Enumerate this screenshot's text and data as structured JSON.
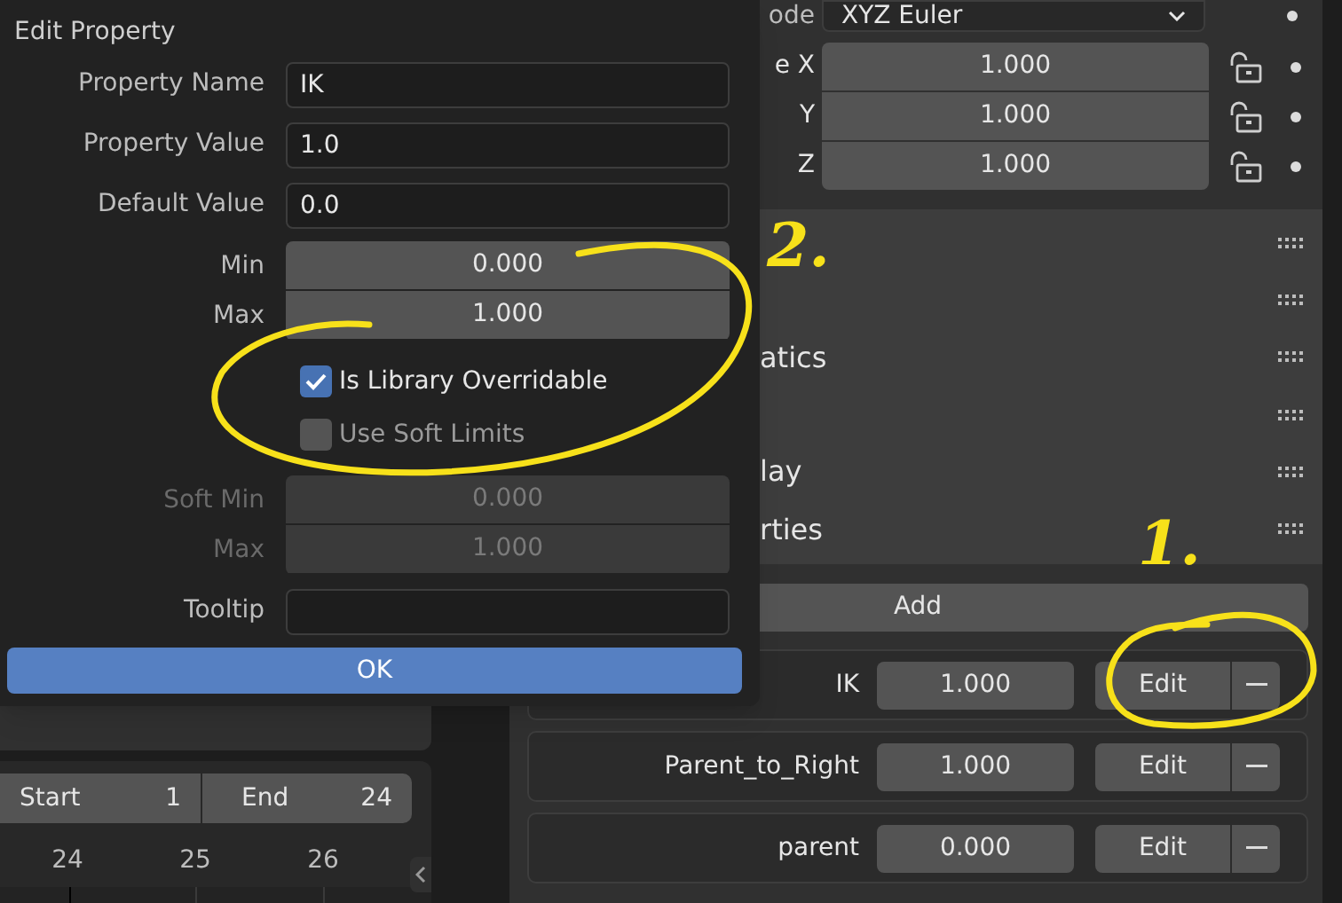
{
  "dialog": {
    "title": "Edit Property",
    "text_fields": [
      {
        "label": "Property Name",
        "value": "IK"
      },
      {
        "label": "Property Value",
        "value": "1.0"
      },
      {
        "label": "Default Value",
        "value": "0.0"
      }
    ],
    "range": {
      "disabled": false,
      "min_label": "Min",
      "min": "0.000",
      "max_label": "Max",
      "max": "1.000"
    },
    "checkboxes": [
      {
        "label": "Is Library Overridable",
        "checked": true
      },
      {
        "label": "Use Soft Limits",
        "checked": false
      }
    ],
    "soft_range": {
      "disabled": true,
      "min_label": "Soft Min",
      "min": "0.000",
      "max_label": "Max",
      "max": "1.000"
    },
    "tooltip": {
      "label": "Tooltip"
    },
    "ok_button": "OK"
  },
  "properties_panel": {
    "mode": {
      "label": "ode",
      "value": "XYZ Euler"
    },
    "scale": [
      {
        "label": "e X",
        "value": "1.000"
      },
      {
        "label": "Y",
        "value": "1.000"
      },
      {
        "label": "Z",
        "value": "1.000"
      }
    ],
    "subpanels": [
      {
        "kind": "covered"
      },
      {
        "kind": "covered"
      },
      {
        "kind": "titled",
        "label": "atics"
      },
      {
        "kind": "covered"
      },
      {
        "kind": "titled",
        "label": "lay"
      },
      {
        "kind": "titled",
        "label": "rties"
      }
    ],
    "add_button": "Add",
    "custom_properties": [
      {
        "name": "IK",
        "value": "1.000",
        "edit": "Edit"
      },
      {
        "name": "Parent_to_Right",
        "value": "1.000",
        "edit": "Edit"
      },
      {
        "name": "parent",
        "value": "0.000",
        "edit": "Edit"
      }
    ]
  },
  "timeline": {
    "start_label": "Start",
    "start": "1",
    "end_label": "End",
    "end": "24",
    "frames": [
      "24",
      "25",
      "26"
    ]
  },
  "annotations": [
    {
      "label": "2."
    },
    {
      "label": "1."
    }
  ]
}
